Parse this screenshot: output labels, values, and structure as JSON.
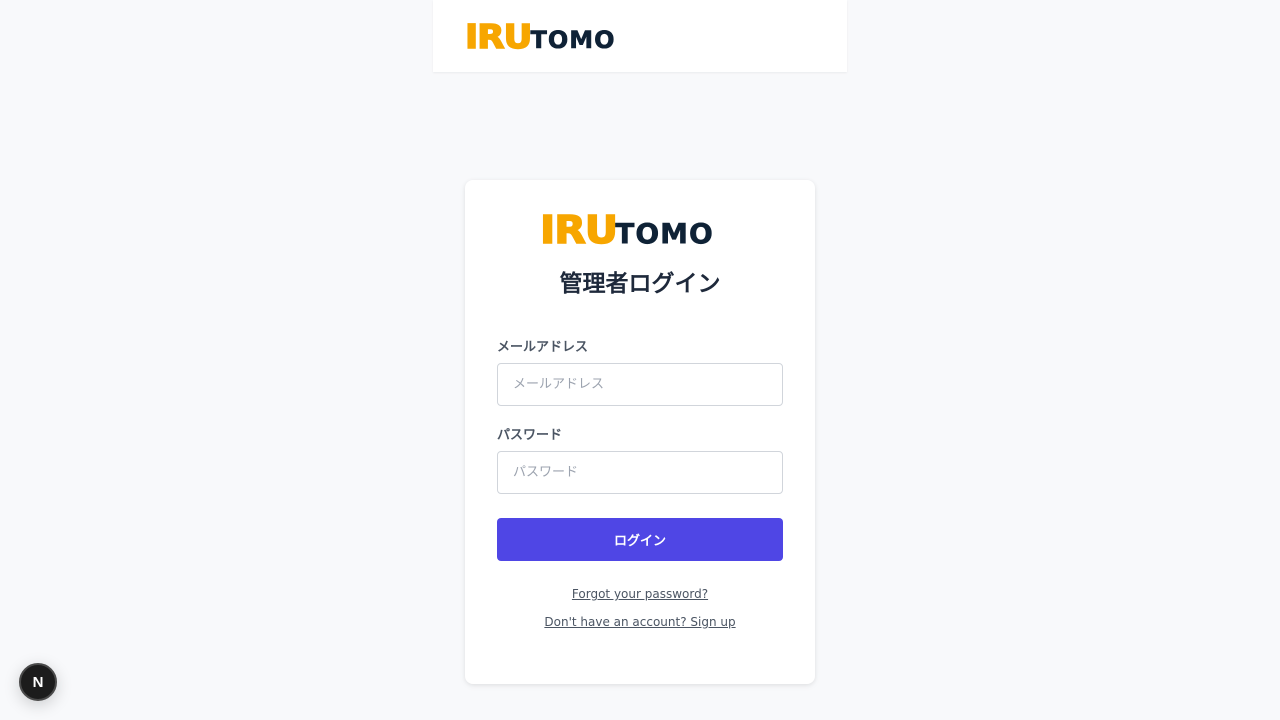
{
  "header": {
    "logo": {
      "part1": "IRU",
      "part2": "TOMO"
    }
  },
  "login_card": {
    "logo": {
      "part1": "IRU",
      "part2": "TOMO"
    },
    "title": "管理者ログイン",
    "email": {
      "label": "メールアドレス",
      "placeholder": "メールアドレス",
      "value": ""
    },
    "password": {
      "label": "パスワード",
      "placeholder": "パスワード",
      "value": ""
    },
    "submit_label": "ログイン",
    "forgot_link": "Forgot your password?",
    "signup_link": "Don't have an account? Sign up"
  },
  "dev_indicator": {
    "label": "N"
  },
  "colors": {
    "logo_orange": "#f7a600",
    "logo_navy": "#0f2236",
    "primary_button": "#4f46e5",
    "page_background": "#f8f9fb"
  },
  "icons": [
    "nextjs-logo-icon"
  ]
}
